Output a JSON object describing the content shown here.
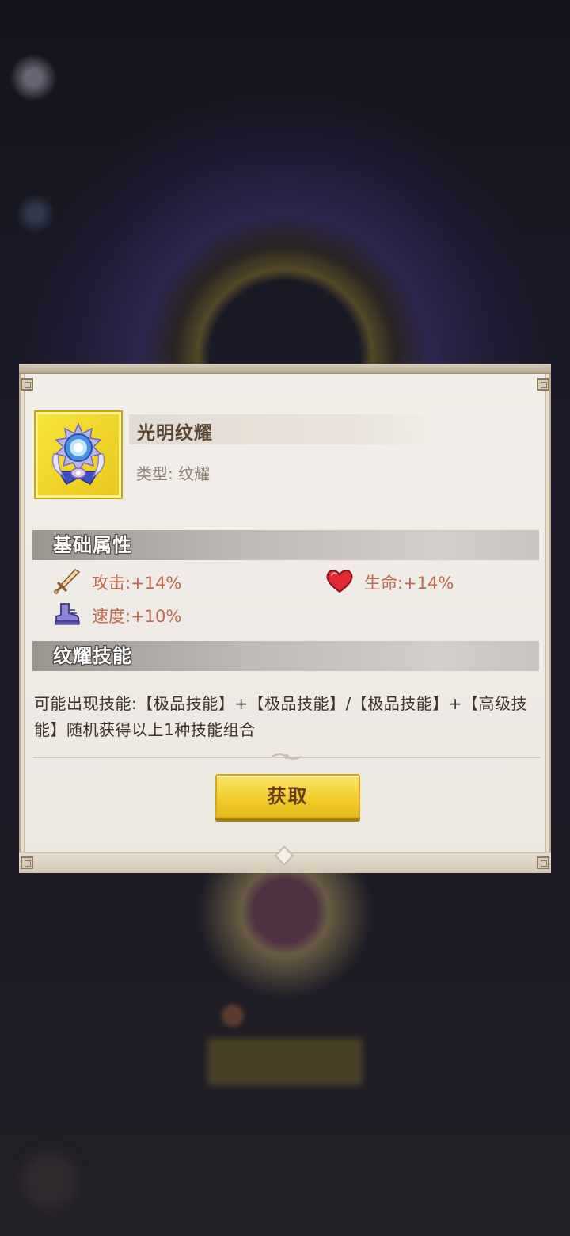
{
  "item": {
    "name": "光明纹耀",
    "type_text": "类型: 纹耀",
    "icon": "radiant-sun-emblem-icon"
  },
  "sections": {
    "base_attributes_title": "基础属性",
    "skill_title": "纹耀技能"
  },
  "stats": {
    "attack": "攻击:+14%",
    "life": "生命:+14%",
    "speed": "速度:+10%"
  },
  "skill": {
    "description": "可能出现技能:【极品技能】+【极品技能】/【极品技能】+【高级技能】随机获得以上1种技能组合"
  },
  "actions": {
    "get_label": "获取"
  },
  "colors": {
    "stat_text": "#c16a4c",
    "button_fill": "#f2ce2c",
    "icon_frame": "#f8e43a",
    "panel_bg": "#f2eee9"
  }
}
